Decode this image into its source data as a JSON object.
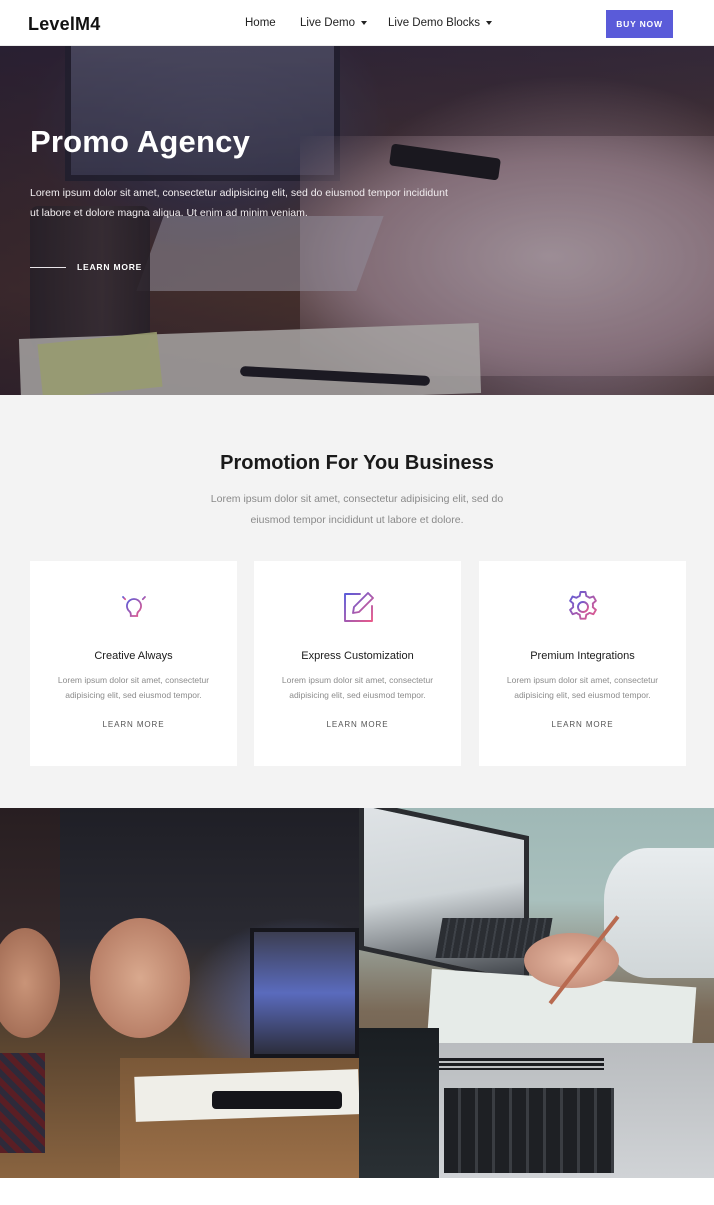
{
  "navbar": {
    "brand": "LevelM4",
    "links": [
      {
        "label": "Home"
      },
      {
        "label": "Live Demo"
      },
      {
        "label": "Live Demo Blocks"
      }
    ],
    "cta": "BUY NOW",
    "accent": "#5a5bd9"
  },
  "hero": {
    "title": "Promo Agency",
    "text": "Lorem ipsum dolor sit amet, consectetur adipisicing elit, sed do eiusmod tempor incididunt ut labore et dolore magna aliqua. Ut enim ad minim veniam.",
    "link": "LEARN MORE"
  },
  "features": {
    "title": "Promotion For You Business",
    "subtitle": "Lorem ipsum dolor sit amet, consectetur adipisicing elit, sed do eiusmod tempor incididunt ut labore et dolore.",
    "cards": [
      {
        "icon": "lightbulb-icon",
        "title": "Creative Always",
        "text": "Lorem ipsum dolor sit amet, consectetur adipisicing elit, sed eiusmod tempor.",
        "link": "LEARN MORE"
      },
      {
        "icon": "edit-icon",
        "title": "Express Customization",
        "text": "Lorem ipsum dolor sit amet, consectetur adipisicing elit, sed eiusmod tempor.",
        "link": "LEARN MORE"
      },
      {
        "icon": "gear-icon",
        "title": "Premium Integrations",
        "text": "Lorem ipsum dolor sit amet, consectetur adipisicing elit, sed eiusmod tempor.",
        "link": "LEARN MORE"
      }
    ],
    "icon_gradient": [
      "#5a5bd9",
      "#e85a8a"
    ]
  }
}
